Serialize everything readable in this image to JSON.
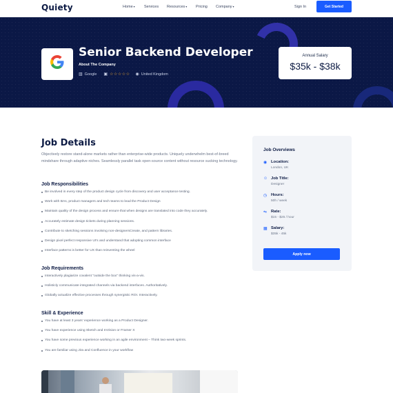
{
  "header": {
    "logo": "Quiety",
    "nav": [
      "Home",
      "Services",
      "Resources",
      "Pricing",
      "Company"
    ],
    "nav_dropdowns": [
      true,
      false,
      true,
      false,
      true
    ],
    "sign_in": "Sign In",
    "cta": "Get Started"
  },
  "hero": {
    "company_logo_letter": "G",
    "title": "Senior Backend Developer",
    "about": "About The Company",
    "company": "Google",
    "rating_stars": "☆☆☆☆☆",
    "location": "United Kingdom",
    "salary_label": "Annual Salary",
    "salary_value": "$35k - $38k"
  },
  "details": {
    "title": "Job Details",
    "intro": "Objectively restore stand-alone markets rather than enterprise-wide products. Uniquely underwhelm best-of-breed mindshare through adaptive niches. Seamlessly parallel task open-source content without resource sucking technology.",
    "responsibilities_title": "Job Responsibilities",
    "responsibilities": [
      "Be involved in every step of the product design cycle from discovery and user acceptance testing.",
      "Work with BAs, product managers and tech teams to lead the Product Design",
      "Maintain quality of the design process and ensure that when designs are translated into code they accurately.",
      "Accurately estimate design tickets during planning sessions.",
      "Contribute to sketching sessions involving non-designersCreate, and pattern libraries.",
      "Design pixel perfect responsive UI's and understand that adopting common interface",
      "Interface patterns is better for UX than reinventing the wheel"
    ],
    "requirements_title": "Job Requirements",
    "requirements": [
      "Interactively plagiarize covalent \"outside the box\" thinking vis-a-vis.",
      "Holisticly communicate integrated channels via backend interfaces. Authoritatively.",
      "Globally actualize effective processes through synergistic ROI. Interactively."
    ],
    "skills_title": "Skill & Experience",
    "skills": [
      "You have at least 3 years' experience working as a Product Designer.",
      "You have experience using Sketch and InVision or Framer X",
      "You have some previous experience working in an agile environment – Think two-week sprints.",
      "You are familiar using Jira and Confluence in your workflow"
    ]
  },
  "overview": {
    "title": "Job Overviews",
    "items": [
      {
        "icon": "location-pin-icon",
        "label": "Location:",
        "value": "London, UK"
      },
      {
        "icon": "user-icon",
        "label": "Job Title:",
        "value": "Designer"
      },
      {
        "icon": "clock-icon",
        "label": "Hours:",
        "value": "50h / week"
      },
      {
        "icon": "rate-tag-icon",
        "label": "Rate:",
        "value": "$15 - $25 / hour"
      },
      {
        "icon": "calendar-icon",
        "label": "Salary:",
        "value": "$35k - 45k"
      }
    ],
    "apply": "Apply now"
  },
  "colors": {
    "primary": "#1a5cff",
    "hero_bg": "#0b1846",
    "heading": "#0d1b44"
  }
}
